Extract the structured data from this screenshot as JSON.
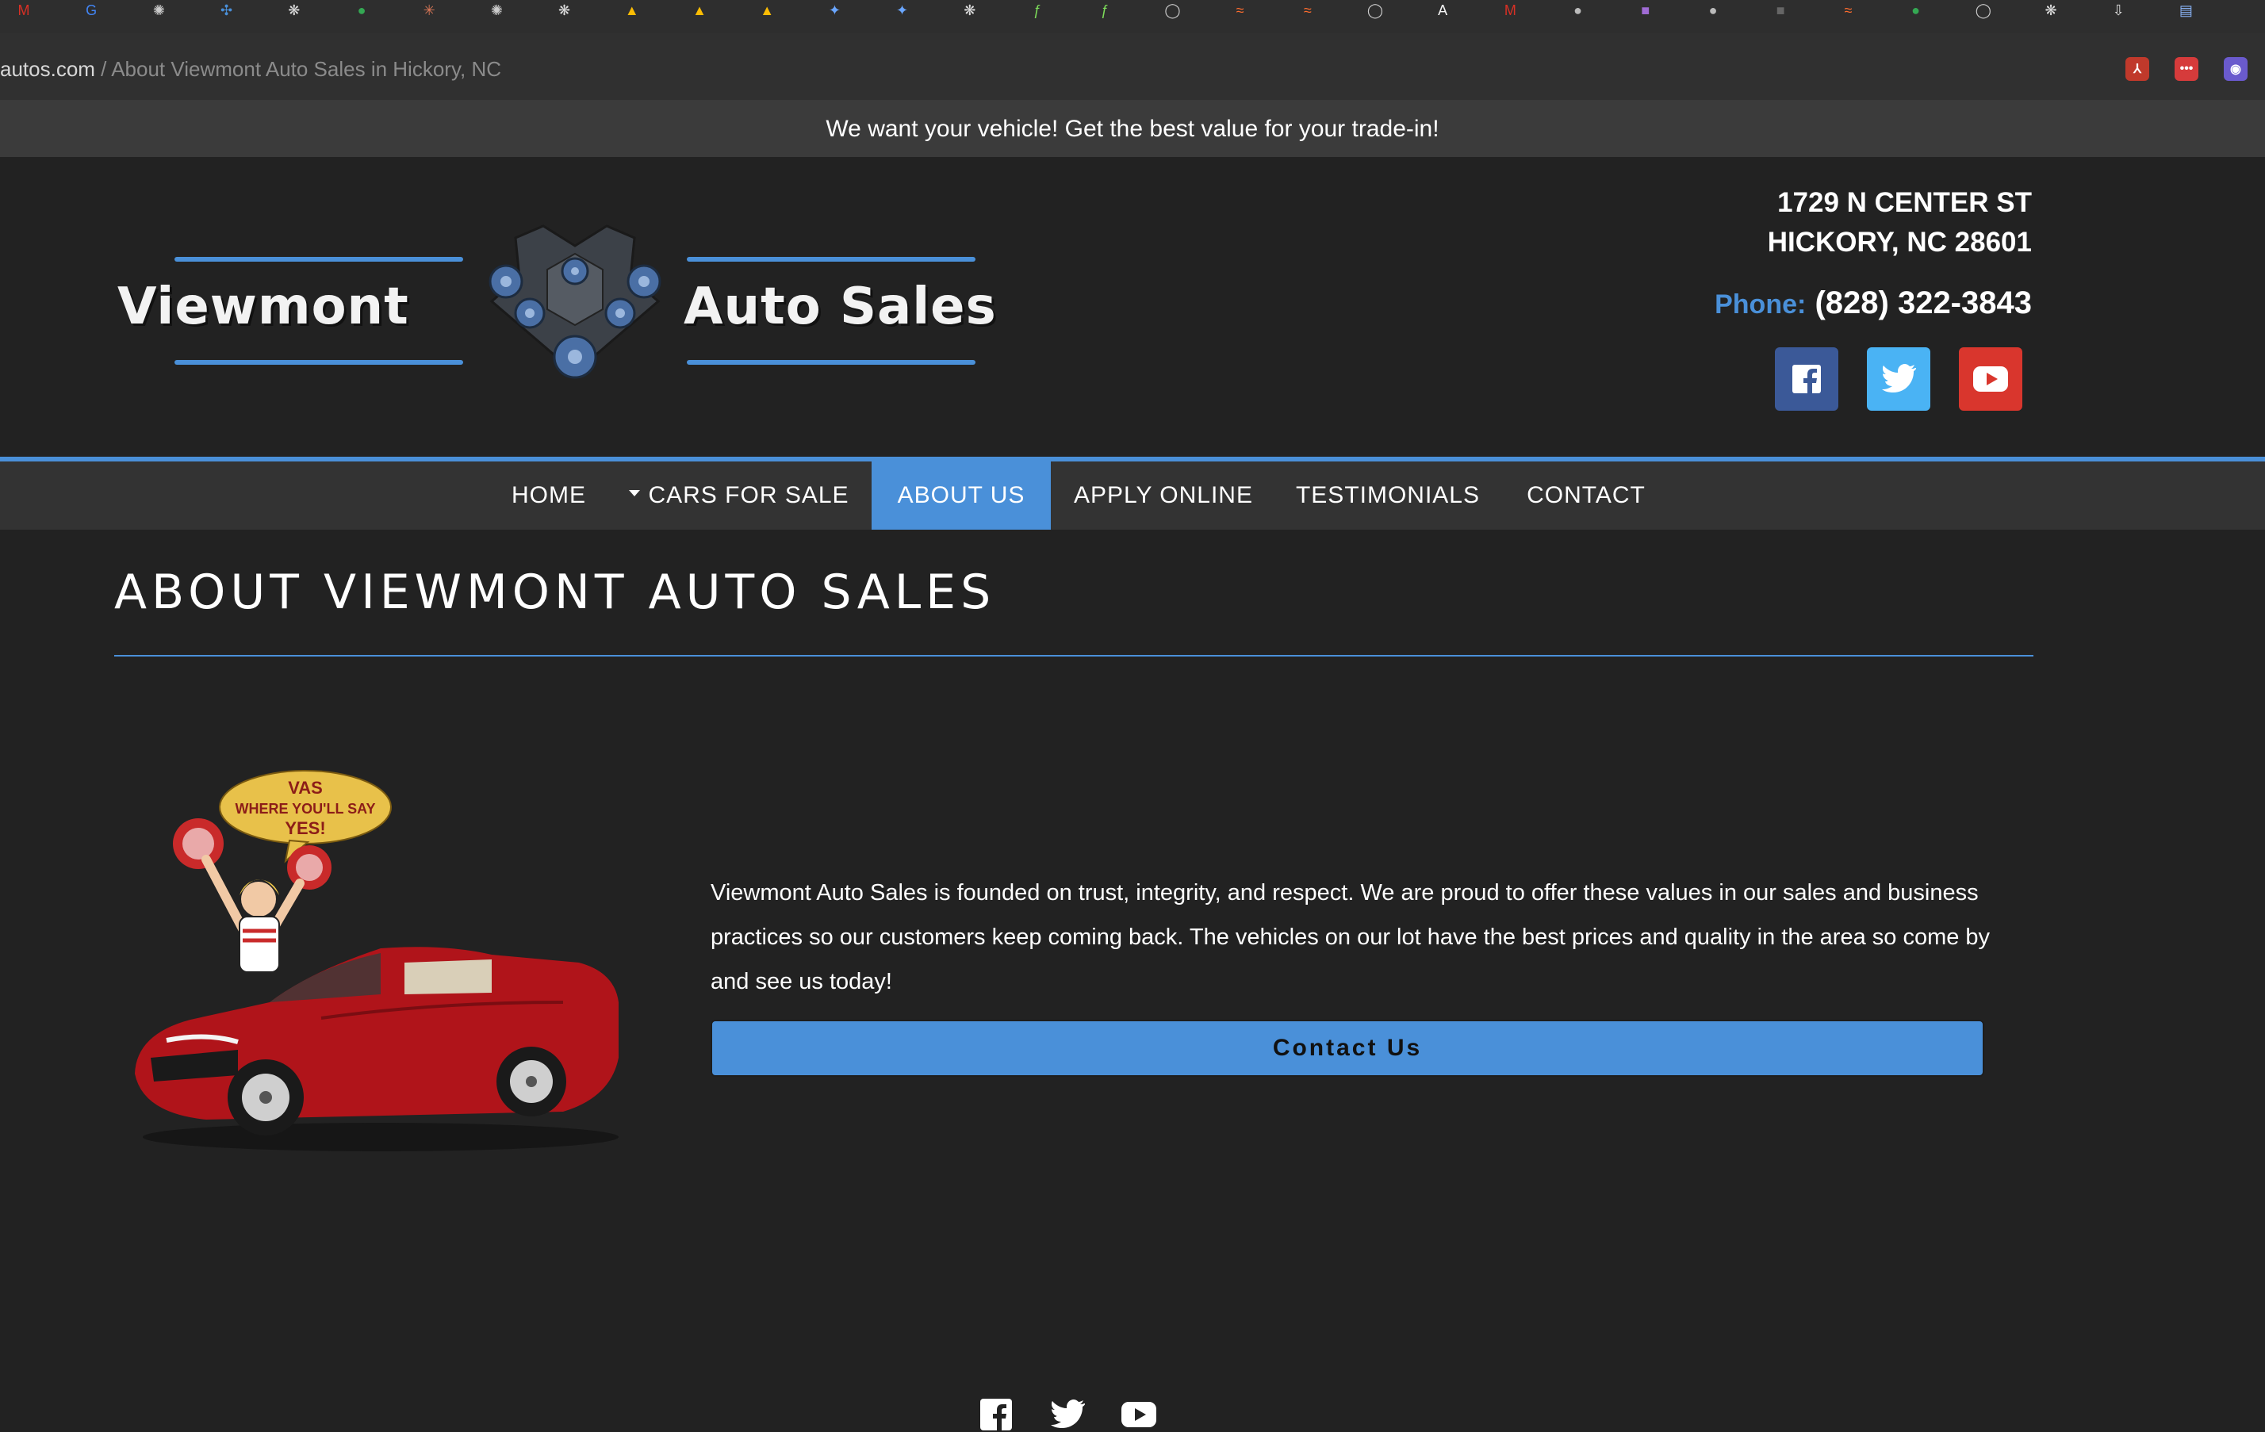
{
  "browser": {
    "url_host": "autos.com",
    "url_separator": " / ",
    "url_title": "About Viewmont Auto Sales in Hickory, NC",
    "bookmarks": [
      {
        "icon": "gmail-icon",
        "color": "#d93025",
        "glyph": "M"
      },
      {
        "icon": "google-icon",
        "color": "#4285f4",
        "glyph": "G"
      },
      {
        "icon": "openai-icon",
        "color": "#cccccc",
        "glyph": "✺"
      },
      {
        "icon": "pinwheel-icon",
        "color": "#4a90d9",
        "glyph": "✣"
      },
      {
        "icon": "perplexity-icon",
        "color": "#dddddd",
        "glyph": "❋"
      },
      {
        "icon": "maps-pin-icon",
        "color": "#34a853",
        "glyph": "●"
      },
      {
        "icon": "claude-icon",
        "color": "#d97757",
        "glyph": "✳"
      },
      {
        "icon": "openai-icon",
        "color": "#cccccc",
        "glyph": "✺"
      },
      {
        "icon": "perplexity-icon",
        "color": "#dddddd",
        "glyph": "❋"
      },
      {
        "icon": "drive-icon",
        "color": "#fbbc04",
        "glyph": "▲"
      },
      {
        "icon": "drive-icon",
        "color": "#fbbc04",
        "glyph": "▲"
      },
      {
        "icon": "drive-icon",
        "color": "#fbbc04",
        "glyph": "▲"
      },
      {
        "icon": "gemini-icon",
        "color": "#6aa6ff",
        "glyph": "✦"
      },
      {
        "icon": "gemini-icon",
        "color": "#6aa6ff",
        "glyph": "✦"
      },
      {
        "icon": "perplexity-icon",
        "color": "#dddddd",
        "glyph": "❋"
      },
      {
        "icon": "feather-icon",
        "color": "#7ddc5a",
        "glyph": "ƒ"
      },
      {
        "icon": "feather-icon",
        "color": "#7ddc5a",
        "glyph": "ƒ"
      },
      {
        "icon": "chat-bubble-icon",
        "color": "#cccccc",
        "glyph": "◯"
      },
      {
        "icon": "make-icon",
        "color": "#ff6d2e",
        "glyph": "≈"
      },
      {
        "icon": "make-icon",
        "color": "#ff6d2e",
        "glyph": "≈"
      },
      {
        "icon": "chat-bubble-icon",
        "color": "#cccccc",
        "glyph": "◯"
      },
      {
        "icon": "anthropic-icon",
        "color": "#f5f5f5",
        "glyph": "A"
      },
      {
        "icon": "gmail-icon",
        "color": "#d93025",
        "glyph": "M"
      },
      {
        "icon": "blob-icon",
        "color": "#bbbbbb",
        "glyph": "●"
      },
      {
        "icon": "app-icon",
        "color": "#a06cd5",
        "glyph": "■"
      },
      {
        "icon": "blob-icon",
        "color": "#bbbbbb",
        "glyph": "●"
      },
      {
        "icon": "square-icon",
        "color": "#666666",
        "glyph": "■"
      },
      {
        "icon": "make-icon",
        "color": "#ff6d2e",
        "glyph": "≈"
      },
      {
        "icon": "maps-pin-icon",
        "color": "#34a853",
        "glyph": "●"
      },
      {
        "icon": "chat-bubble-icon",
        "color": "#cccccc",
        "glyph": "◯"
      },
      {
        "icon": "perplexity-icon",
        "color": "#dddddd",
        "glyph": "❋"
      },
      {
        "icon": "download-icon",
        "color": "#dddddd",
        "glyph": "⇩"
      },
      {
        "icon": "docs-icon",
        "color": "#8ab4f8",
        "glyph": "▤"
      }
    ],
    "extensions": [
      {
        "icon": "pdf-icon",
        "color": "#c0392b",
        "glyph": "⅄"
      },
      {
        "icon": "more-icon",
        "color": "#d63b3b",
        "glyph": "•••"
      },
      {
        "icon": "robot-icon",
        "color": "#6a5acd",
        "glyph": "◉"
      }
    ]
  },
  "promo": {
    "text": "We want your vehicle! Get the best value for your trade-in!"
  },
  "header": {
    "logo_left": "Viewmont",
    "logo_right": "Auto Sales",
    "address_line1": "1729 N CENTER ST",
    "address_line2": "HICKORY, NC 28601",
    "phone_label": "Phone:",
    "phone_number": "(828) 322-3843",
    "social": [
      {
        "name": "facebook",
        "color": "#3b5998"
      },
      {
        "name": "twitter",
        "color": "#4ab3f4"
      },
      {
        "name": "youtube",
        "color": "#d9362d"
      }
    ]
  },
  "nav": {
    "items": [
      {
        "label": "HOME",
        "active": false
      },
      {
        "label": "CARS FOR SALE",
        "active": false,
        "dropdown": true
      },
      {
        "label": "ABOUT US",
        "active": true
      },
      {
        "label": "APPLY ONLINE",
        "active": false
      },
      {
        "label": "TESTIMONIALS",
        "active": false
      },
      {
        "label": "CONTACT",
        "active": false
      }
    ]
  },
  "main": {
    "title": "ABOUT VIEWMONT AUTO SALES",
    "about_text": "Viewmont Auto Sales is founded on trust, integrity, and respect. We are proud to offer these values in our sales and business practices so our customers keep coming back. The vehicles on our lot have the best prices and quality in the area so come by and see us today!",
    "contact_button": "Contact Us",
    "speech_bubble": {
      "line1": "VAS",
      "line2": "WHERE YOU'LL SAY",
      "line3": "YES!"
    }
  },
  "colors": {
    "accent": "#4a90d9",
    "background": "#222222",
    "promo_bar": "#3b3b3b",
    "nav_bar": "#333333",
    "car_red": "#b0141a",
    "bubble_yellow": "#e8c14a"
  }
}
